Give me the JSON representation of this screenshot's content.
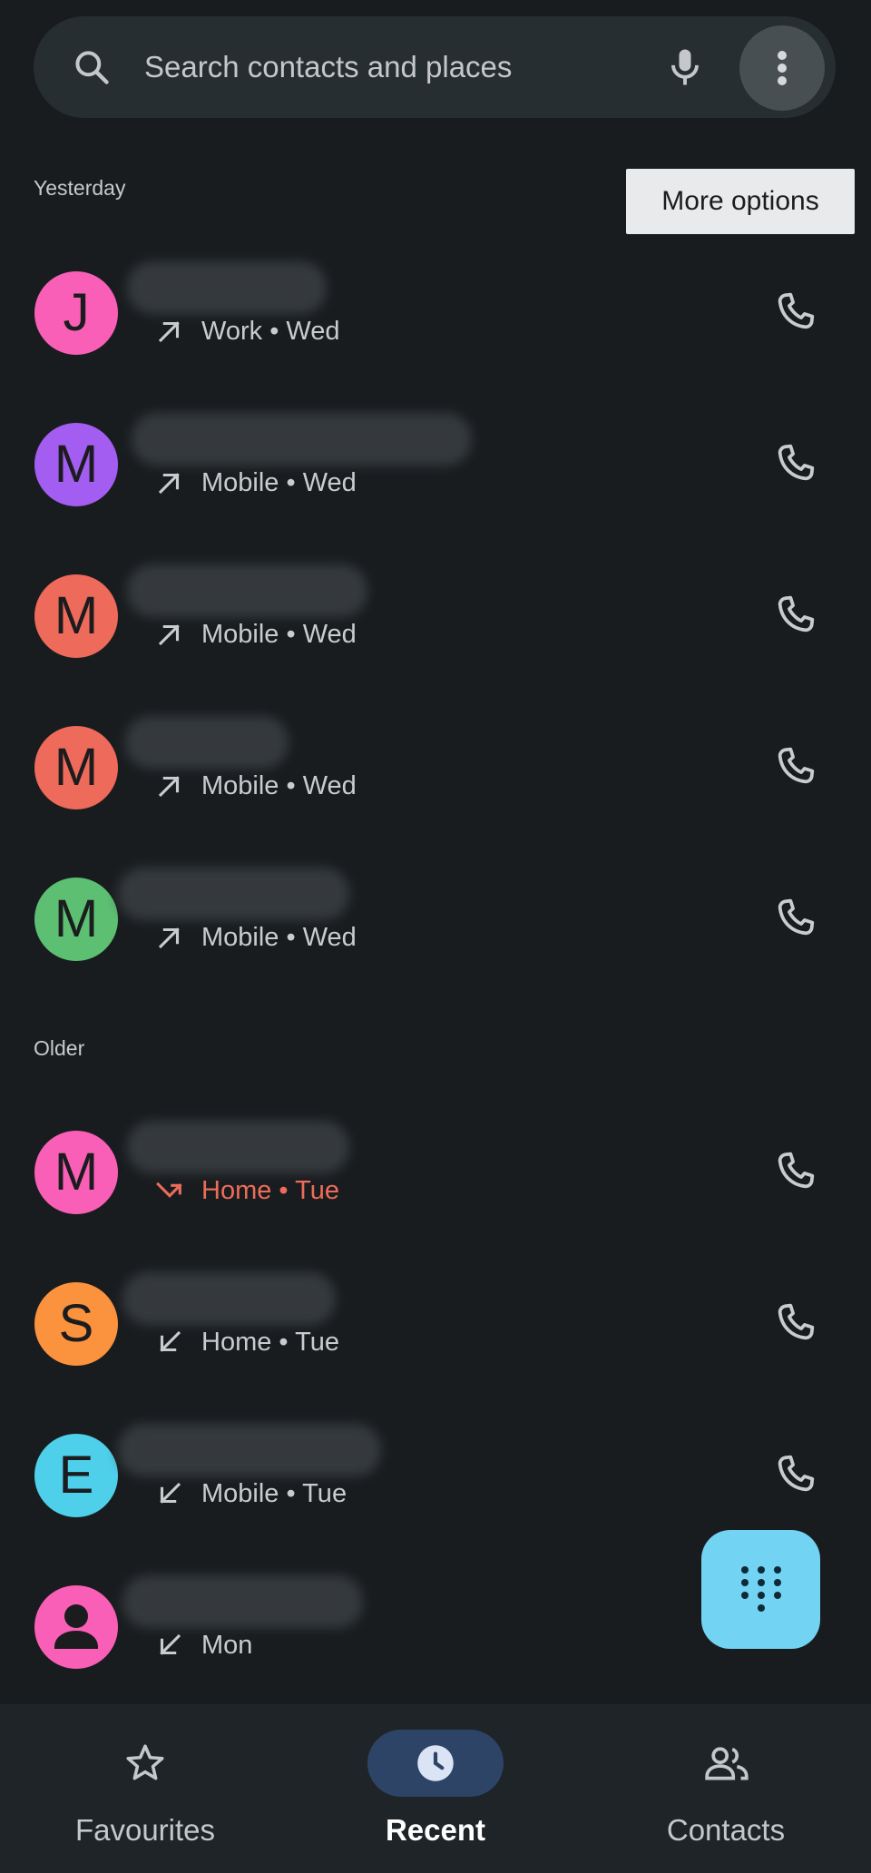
{
  "search": {
    "placeholder": "Search contacts and places"
  },
  "tooltip": "More options",
  "sections": {
    "yesterday": "Yesterday",
    "older": "Older"
  },
  "calls": [
    {
      "initial": "J",
      "avatar_color": "#f95fb6",
      "direction": "outgoing",
      "detail": "Work • Wed"
    },
    {
      "initial": "M",
      "avatar_color": "#a35df0",
      "direction": "outgoing",
      "detail": "Mobile • Wed"
    },
    {
      "initial": "M",
      "avatar_color": "#ee6a5b",
      "direction": "outgoing",
      "detail": "Mobile • Wed"
    },
    {
      "initial": "M",
      "avatar_color": "#ee6a5b",
      "direction": "outgoing",
      "detail": "Mobile • Wed"
    },
    {
      "initial": "M",
      "avatar_color": "#5cbf72",
      "direction": "outgoing",
      "detail": "Mobile • Wed"
    },
    {
      "initial": "M",
      "avatar_color": "#f95fb6",
      "direction": "missed",
      "detail": "Home • Tue"
    },
    {
      "initial": "S",
      "avatar_color": "#fb923d",
      "direction": "incoming",
      "detail": "Home • Tue"
    },
    {
      "initial": "E",
      "avatar_color": "#4fd0ea",
      "direction": "incoming",
      "detail": "Mobile • Tue"
    },
    {
      "initial": "",
      "avatar_color": "#f95fb6",
      "direction": "incoming",
      "detail": "Mon"
    }
  ],
  "nav": {
    "favourites": "Favourites",
    "recent": "Recent",
    "contacts": "Contacts"
  },
  "colors": {
    "accent_fab": "#72d3f3",
    "missed": "#ec6c59",
    "nav_active": "#2d4467"
  }
}
